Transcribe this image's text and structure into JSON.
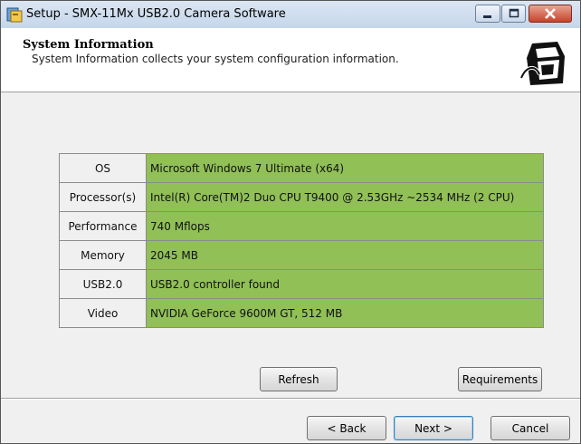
{
  "window": {
    "title": "Setup - SMX-11Mx USB2.0 Camera Software"
  },
  "header": {
    "title": "System Information",
    "subtitle": "System Information collects your system configuration information."
  },
  "system_info": [
    {
      "label": "OS",
      "value": "Microsoft Windows 7 Ultimate (x64)"
    },
    {
      "label": "Processor(s)",
      "value": "Intel(R) Core(TM)2 Duo CPU T9400 @ 2.53GHz ~2534 MHz (2 CPU)"
    },
    {
      "label": "Performance",
      "value": "740 Mflops"
    },
    {
      "label": "Memory",
      "value": "2045 MB"
    },
    {
      "label": "USB2.0",
      "value": "USB2.0 controller found"
    },
    {
      "label": "Video",
      "value": "NVIDIA GeForce 9600M GT, 512 MB"
    }
  ],
  "buttons": {
    "refresh": "Refresh",
    "requirements": "Requirements",
    "back": "< Back",
    "next": "Next >",
    "cancel": "Cancel"
  },
  "colors": {
    "value_cell": "#91c057",
    "window_bg": "#f0f0f0"
  }
}
